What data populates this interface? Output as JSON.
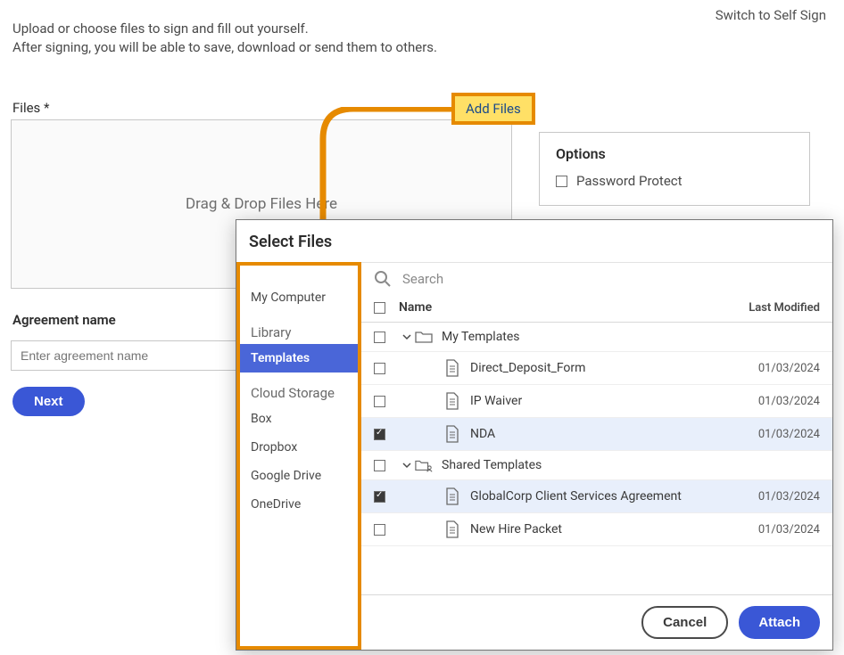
{
  "top_link": "Switch to Self Sign",
  "intro_line1": "Upload or choose files to sign and fill out yourself.",
  "intro_line2": "After signing, you will be able to save, download or send them to others.",
  "files_label": "Files *",
  "dropzone_text": "Drag & Drop Files Here",
  "add_files": "Add Files",
  "options": {
    "title": "Options",
    "password_protect": "Password Protect"
  },
  "agreement": {
    "label": "Agreement name",
    "placeholder": "Enter agreement name"
  },
  "next": "Next",
  "modal": {
    "title": "Select Files",
    "search_placeholder": "Search",
    "columns": {
      "name": "Name",
      "last_modified": "Last Modified"
    },
    "sidebar": {
      "my_computer": "My Computer",
      "library": "Library",
      "templates": "Templates",
      "cloud_storage": "Cloud Storage",
      "box": "Box",
      "dropbox": "Dropbox",
      "google_drive": "Google Drive",
      "onedrive": "OneDrive"
    },
    "groups": [
      {
        "name": "My Templates",
        "items": [
          {
            "name": "Direct_Deposit_Form",
            "date": "01/03/2024",
            "checked": false
          },
          {
            "name": "IP Waiver",
            "date": "01/03/2024",
            "checked": false
          },
          {
            "name": "NDA",
            "date": "01/03/2024",
            "checked": true
          }
        ]
      },
      {
        "name": "Shared Templates",
        "items": [
          {
            "name": "GlobalCorp Client Services Agreement",
            "date": "01/03/2024",
            "checked": true
          },
          {
            "name": "New Hire Packet",
            "date": "01/03/2024",
            "checked": false
          }
        ]
      }
    ],
    "cancel": "Cancel",
    "attach": "Attach"
  }
}
